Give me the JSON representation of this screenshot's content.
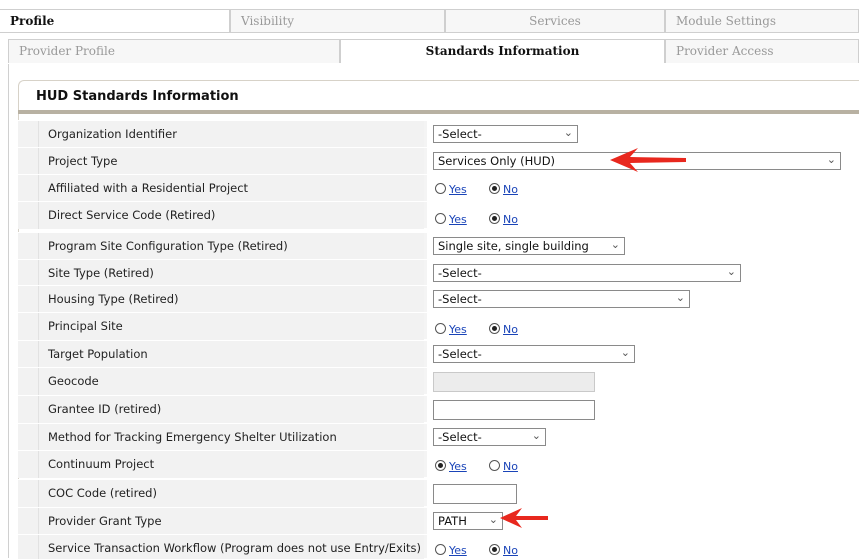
{
  "tabs_top": [
    "Profile",
    "Visibility",
    "Services",
    "Module Settings"
  ],
  "tabs_sub": [
    "Provider Profile",
    "Standards Information",
    "Provider Access"
  ],
  "panel_title": "HUD Standards Information",
  "rows": [
    {
      "label": "Organization Identifier",
      "select": "-Select-"
    },
    {
      "label": "Project Type",
      "select": "Services Only (HUD)"
    },
    {
      "label": "Affiliated with a Residential Project",
      "yes": "Yes",
      "no": "No",
      "selected": "No"
    },
    {
      "label": "Direct Service Code (Retired)",
      "yes": "Yes",
      "no": "No",
      "selected": "No"
    },
    {
      "label": "Program Site Configuration Type (Retired)",
      "select": "Single site, single building"
    },
    {
      "label": "Site Type (Retired)",
      "select": "-Select-"
    },
    {
      "label": "Housing Type (Retired)",
      "select": "-Select-"
    },
    {
      "label": "Principal Site",
      "yes": "Yes",
      "no": "No",
      "selected": "No"
    },
    {
      "label": "Target Population",
      "select": "-Select-"
    },
    {
      "label": "Geocode",
      "value": ""
    },
    {
      "label": "Grantee ID (retired)",
      "value": ""
    },
    {
      "label": "Method for Tracking Emergency Shelter Utilization",
      "select": "-Select-"
    },
    {
      "label": "Continuum Project",
      "yes": "Yes",
      "no": "No",
      "selected": "Yes"
    },
    {
      "label": "COC Code (retired)",
      "value": ""
    },
    {
      "label": "Provider Grant Type",
      "select": "PATH"
    },
    {
      "label": "Service Transaction Workflow (Program does not use Entry/Exits)",
      "yes": "Yes",
      "no": "No",
      "selected": "No"
    }
  ],
  "colors": {
    "arrow": "#e8281e",
    "link": "#1a44b8",
    "rule": "#b8b1a2"
  }
}
